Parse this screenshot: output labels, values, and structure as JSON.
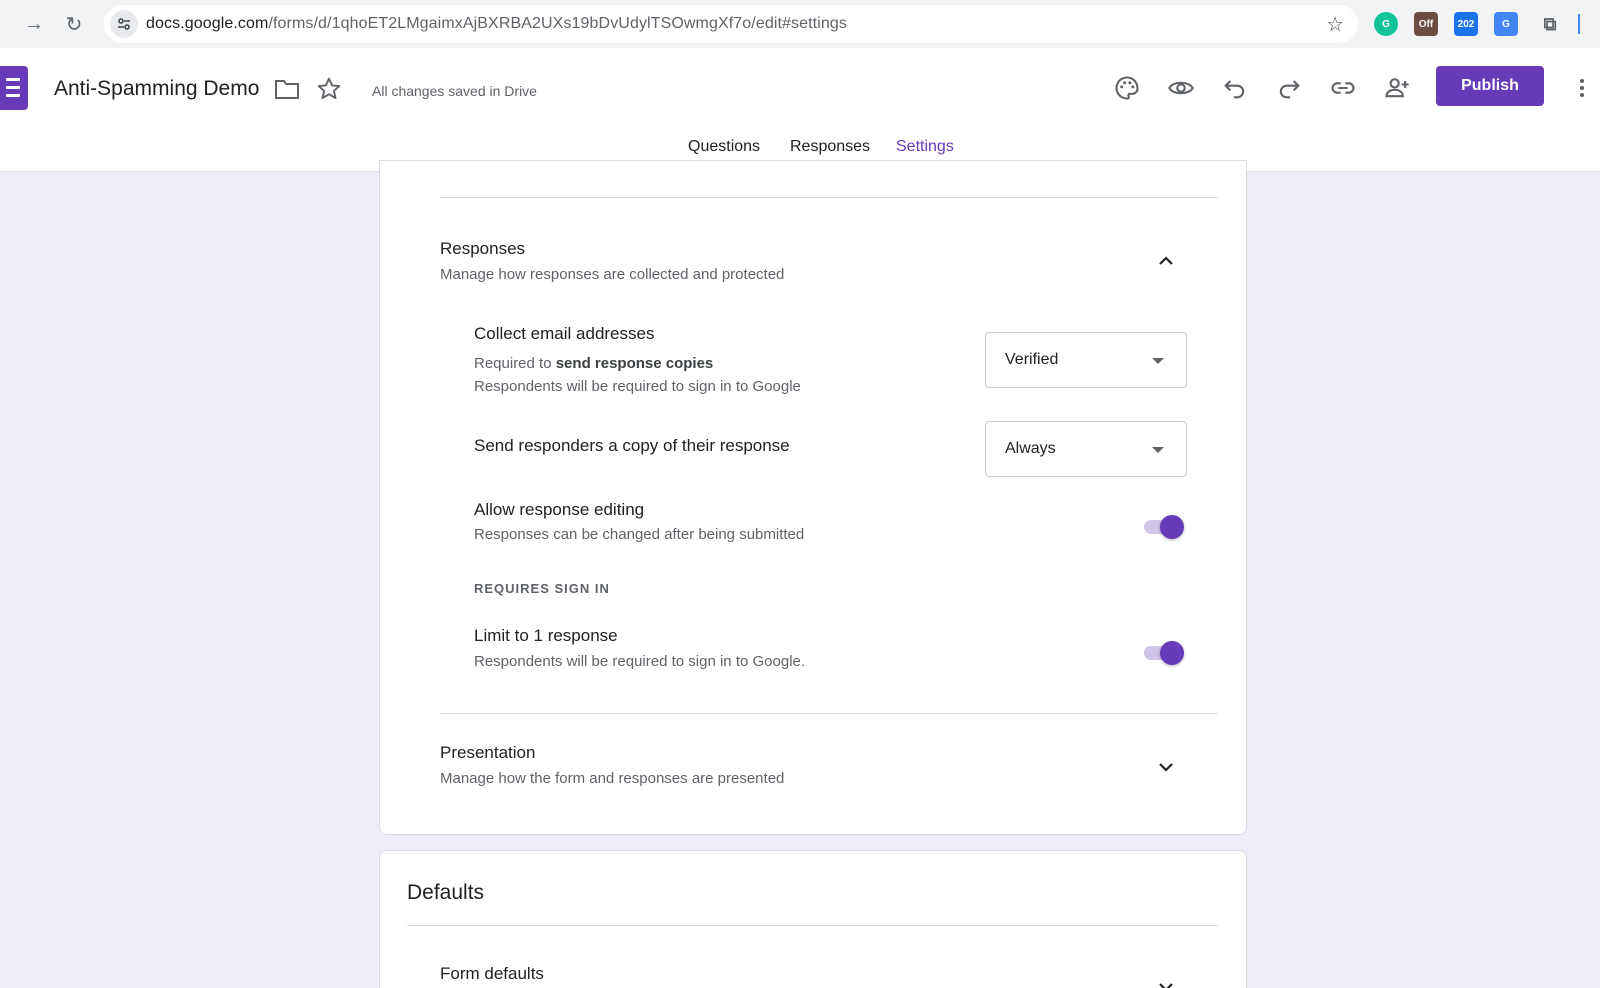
{
  "browser": {
    "url_host": "docs.google.com",
    "url_path": "/forms/d/1qhoET2LMgaimxAjBXRBA2UXs19bDvUdylTSOwmgXf7o/edit#settings",
    "extensions": [
      {
        "name": "grammarly-icon",
        "color": "#15c39a",
        "label": ""
      },
      {
        "name": "off-badge-icon",
        "color": "#6d4c41",
        "label": "Off"
      },
      {
        "name": "calendar-badge-icon",
        "color": "#1a73e8",
        "label": "202"
      },
      {
        "name": "translate-icon",
        "color": "#4285f4",
        "label": ""
      },
      {
        "name": "puzzle-icon",
        "color": "#5f6368",
        "label": ""
      }
    ]
  },
  "header": {
    "doc_title": "Anti-Spamming Demo",
    "save_status": "All changes saved in Drive",
    "publish_label": "Publish",
    "accent": "#673ab7"
  },
  "tabs": [
    {
      "label": "Questions",
      "active": false
    },
    {
      "label": "Responses",
      "active": false
    },
    {
      "label": "Settings",
      "active": true
    }
  ],
  "responses_section": {
    "title": "Responses",
    "subtitle": "Manage how responses are collected and protected",
    "expanded": true,
    "collect_email": {
      "title": "Collect email addresses",
      "sub_prefix": "Required to ",
      "sub_bold": "send response copies",
      "sub_line2": "Respondents will be required to sign in to Google",
      "value": "Verified"
    },
    "send_copy": {
      "title": "Send responders a copy of their response",
      "value": "Always"
    },
    "allow_editing": {
      "title": "Allow response editing",
      "subtitle": "Responses can be changed after being submitted",
      "enabled": true
    },
    "requires_sign_in_label": "REQUIRES SIGN IN",
    "limit_response": {
      "title": "Limit to 1 response",
      "subtitle": "Respondents will be required to sign in to Google.",
      "enabled": true
    }
  },
  "presentation_section": {
    "title": "Presentation",
    "subtitle": "Manage how the form and responses are presented",
    "expanded": false
  },
  "defaults_card": {
    "title": "Defaults",
    "form_defaults_title": "Form defaults"
  }
}
